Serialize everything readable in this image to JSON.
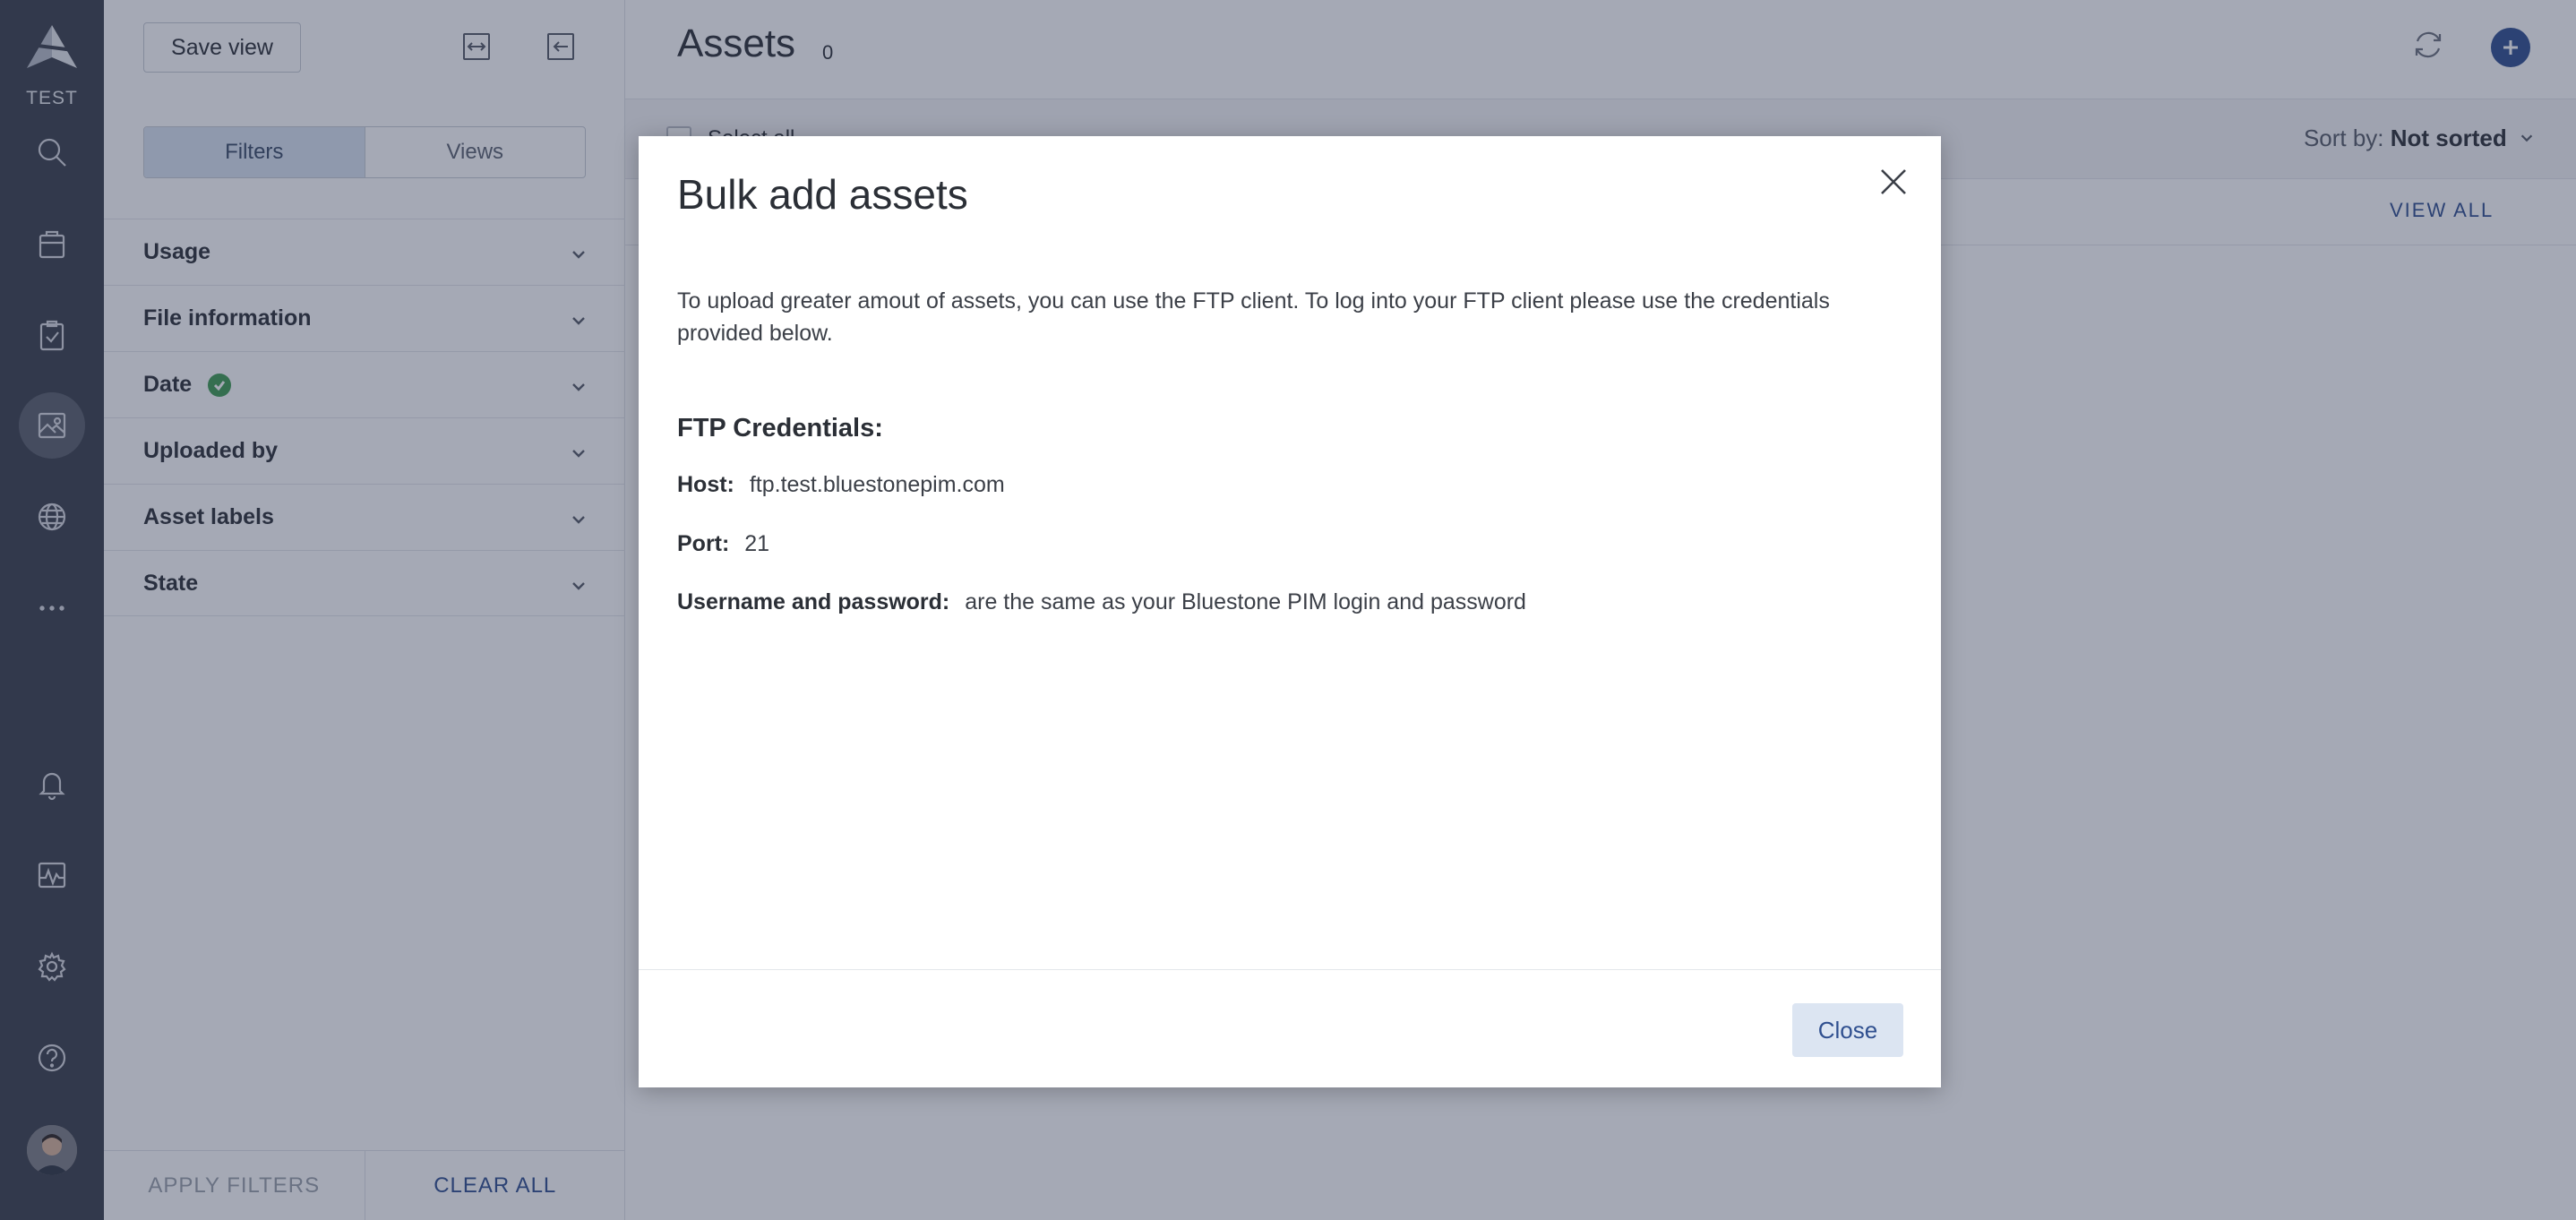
{
  "rail": {
    "env_label": "TEST",
    "items": [
      {
        "icon": "search-icon"
      },
      {
        "icon": "products-icon"
      },
      {
        "icon": "tasks-icon"
      },
      {
        "icon": "assets-icon"
      },
      {
        "icon": "globe-icon"
      },
      {
        "icon": "more-icon"
      },
      {
        "icon": "bell-icon"
      },
      {
        "icon": "activity-icon"
      },
      {
        "icon": "gear-icon"
      },
      {
        "icon": "help-icon"
      }
    ]
  },
  "panel": {
    "save_view": "Save view",
    "tabs": [
      "Filters",
      "Views"
    ],
    "filters": [
      "Usage",
      "File information",
      "Date",
      "Uploaded by",
      "Asset labels",
      "State"
    ],
    "apply": "APPLY FILTERS",
    "clear": "CLEAR ALL"
  },
  "main": {
    "title": "Assets",
    "count": "0",
    "select_all": "Select all",
    "sort_prefix": "Sort by:",
    "sort_value": "Not sorted",
    "view_all": "VIEW ALL"
  },
  "modal": {
    "title": "Bulk add assets",
    "description": "To upload greater amout of assets, you can use the FTP client. To log into your FTP client please use the credentials provided below.",
    "heading": "FTP Credentials:",
    "host_label": "Host:",
    "host_value": "ftp.test.bluestonepim.com",
    "port_label": "Port:",
    "port_value": "21",
    "user_label": "Username and password:",
    "user_value": "are the same as your Bluestone PIM login and password",
    "close_button": "Close"
  },
  "colors": {
    "rail": "#3a3f4a",
    "accent": "#2f4f8f",
    "success": "#3f9b52"
  }
}
